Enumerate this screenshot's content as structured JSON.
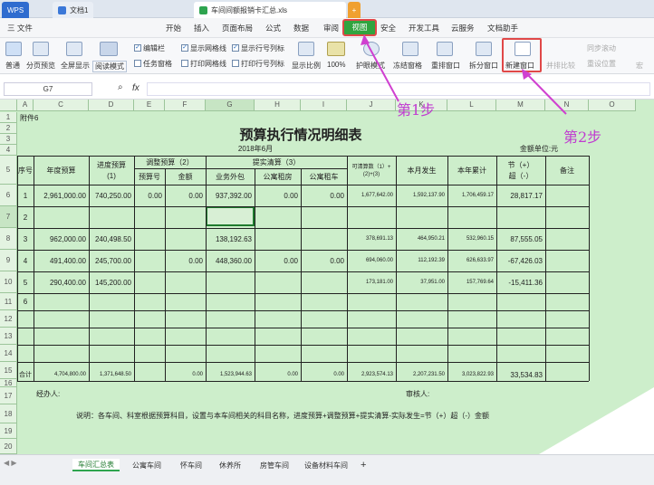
{
  "tabs": {
    "app": "WPS",
    "doc1": "文档1",
    "doc2": "车间间额报销卡汇总.xls",
    "add": "+"
  },
  "menu": {
    "file": "三 文件",
    "items": [
      "开始",
      "插入",
      "页面布局",
      "公式",
      "数据",
      "审阅",
      "视图",
      "安全",
      "开发工具",
      "云服务",
      "文档助手"
    ]
  },
  "ribbon": {
    "normal": "普通",
    "pagebreak": "分页预览",
    "fullscreen": "全屏显示",
    "readmode": "阅读模式",
    "editbar": "编辑栏",
    "taskpane": "任务窗格",
    "gridlines": "显示网格线",
    "printgrid": "打印网格线",
    "rowcol": "显示行号列标",
    "printrowcol": "打印行号列标",
    "zoom": "显示比例",
    "zoom100": "100%",
    "eyecare": "护眼模式",
    "freeze": "冻结窗格",
    "rearrange": "重排窗口",
    "split": "拆分窗口",
    "newwindow": "新建窗口",
    "sidebyside": "并排比较",
    "sync": "同步滚动",
    "reset": "重设位置",
    "macro": "宏"
  },
  "formula": {
    "cellref": "G7",
    "fx": "fx"
  },
  "annotations": {
    "step1": "第1步",
    "step2": "第2步"
  },
  "columns": [
    "A",
    "B",
    "C",
    "D",
    "E",
    "F",
    "G",
    "H",
    "I",
    "J",
    "K",
    "L",
    "M",
    "N",
    "O"
  ],
  "rows": [
    "1",
    "2",
    "3",
    "4",
    "5",
    "6",
    "7",
    "8",
    "9",
    "10",
    "11",
    "12",
    "13",
    "14",
    "15",
    "16",
    "17",
    "18",
    "19",
    "20"
  ],
  "sheet": {
    "a1": "附件6",
    "title": "预算执行情况明细表",
    "date": "2018年6月",
    "unit": "金额单位:元",
    "h": {
      "seq": "序号",
      "annual": "年度预算",
      "progress": "进度预算",
      "progress2": "(1)",
      "adjust": "调整预算（2）",
      "docno": "预算号",
      "amount": "金额",
      "actual": "提实清算（3）",
      "outsource": "业务外包",
      "aptrent": "公寓租房",
      "aptcar": "公寓租车",
      "avail": "可清算数（1）+",
      "avail2": "(2)+(3)",
      "month": "本月发生",
      "ytd": "本年累计",
      "diff": "节（+）",
      "diff2": "超（-）",
      "note": "备注"
    },
    "data": [
      {
        "no": "1",
        "annual": "2,961,000.00",
        "prog": "740,250.00",
        "docno": "0.00",
        "amt": "0.00",
        "out": "937,392.00",
        "rent": "0.00",
        "car": "0.00",
        "avail": "1,677,642.00",
        "month": "1,592,137.90",
        "ytd": "1,706,459.17",
        "diff": "28,817.17"
      },
      {
        "no": "2",
        "annual": "",
        "prog": "",
        "docno": "",
        "amt": "",
        "out": "",
        "rent": "",
        "car": "",
        "avail": "",
        "month": "",
        "ytd": "",
        "diff": ""
      },
      {
        "no": "3",
        "annual": "962,000.00",
        "prog": "240,498.50",
        "docno": "",
        "amt": "",
        "out": "138,192.63",
        "rent": "",
        "car": "",
        "avail": "378,691.13",
        "month": "464,950.21",
        "ytd": "532,960.15",
        "diff": "87,555.05"
      },
      {
        "no": "4",
        "annual": "491,400.00",
        "prog": "245,700.00",
        "docno": "",
        "amt": "0.00",
        "out": "448,360.00",
        "rent": "0.00",
        "car": "0.00",
        "avail": "694,060.00",
        "month": "112,192.39",
        "ytd": "626,633.97",
        "diff": "-67,426.03"
      },
      {
        "no": "5",
        "annual": "290,400.00",
        "prog": "145,200.00",
        "docno": "",
        "amt": "",
        "out": "",
        "rent": "",
        "car": "",
        "avail": "173,181.00",
        "month": "37,951.00",
        "ytd": "157,769.64",
        "diff": "-15,411.36"
      },
      {
        "no": "6",
        "annual": "",
        "prog": "",
        "docno": "",
        "amt": "",
        "out": "",
        "rent": "",
        "car": "",
        "avail": "",
        "month": "",
        "ytd": "",
        "diff": ""
      }
    ],
    "total": {
      "label": "合计",
      "annual": "4,704,800.00",
      "prog": "1,371,648.50",
      "amt": "0.00",
      "out": "1,523,944.63",
      "rent": "0.00",
      "car": "0.00",
      "avail": "2,923,574.13",
      "month": "2,207,231.50",
      "ytd": "3,023,822.93",
      "diff": "33,534.83"
    },
    "handler": "经办人:",
    "reviewer": "审核人:",
    "note": "说明：各车间、科室根据预算科目，设置与本车间相关的科目名称，进度预算+调整预算+提实清算-实际发生=节（+）超（-）金额"
  },
  "sheettabs": [
    "车间汇总表",
    "公寓车间",
    "怀车间",
    "休养所",
    "房管车间",
    "设备材料车间",
    "+"
  ]
}
